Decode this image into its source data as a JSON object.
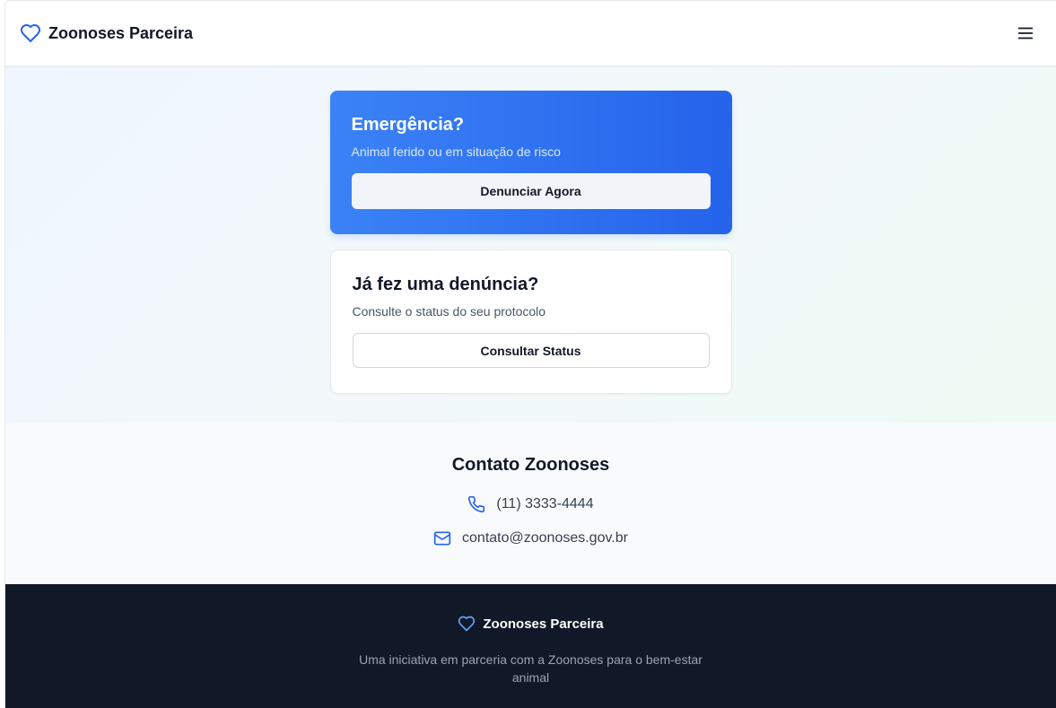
{
  "header": {
    "brand_name": "Zoonoses Parceira",
    "brand_icon": "heart-icon",
    "menu_icon": "menu-icon"
  },
  "emergency_card": {
    "title": "Emergência?",
    "subtitle": "Animal ferido ou em situação de risco",
    "button_label": "Denunciar Agora"
  },
  "status_card": {
    "title": "Já fez uma denúncia?",
    "subtitle": "Consulte o status do seu protocolo",
    "button_label": "Consultar Status"
  },
  "contact": {
    "title": "Contato Zoonoses",
    "phone": "(11) 3333-4444",
    "email": "contato@zoonoses.gov.br"
  },
  "footer": {
    "brand_name": "Zoonoses Parceira",
    "description": "Uma iniciativa em parceria com a Zoonoses para o bem-estar animal"
  },
  "colors": {
    "primary": "#2563eb",
    "dark": "#111827",
    "light_bg": "#f8fafc"
  }
}
